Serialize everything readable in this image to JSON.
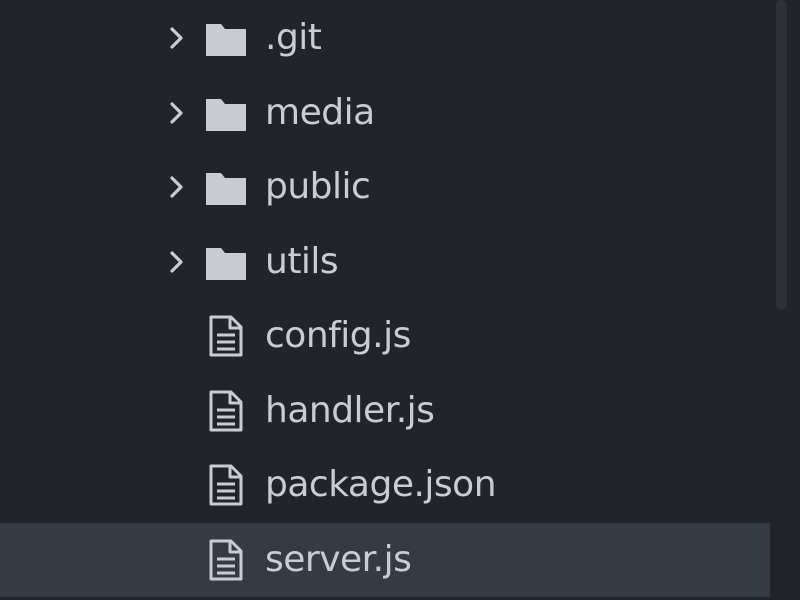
{
  "tree": {
    "items": [
      {
        "label": ".git",
        "type": "folder",
        "icon": "folder-icon",
        "expanded": false,
        "selected": false
      },
      {
        "label": "media",
        "type": "folder",
        "icon": "folder-icon",
        "expanded": false,
        "selected": false
      },
      {
        "label": "public",
        "type": "folder",
        "icon": "folder-icon",
        "expanded": false,
        "selected": false
      },
      {
        "label": "utils",
        "type": "folder",
        "icon": "folder-icon",
        "expanded": false,
        "selected": false
      },
      {
        "label": "config.js",
        "type": "file",
        "icon": "file-icon",
        "selected": false
      },
      {
        "label": "handler.js",
        "type": "file",
        "icon": "file-icon",
        "selected": false
      },
      {
        "label": "package.json",
        "type": "file",
        "icon": "file-icon",
        "selected": false
      },
      {
        "label": "server.js",
        "type": "file",
        "icon": "file-icon",
        "selected": true
      }
    ]
  },
  "colors": {
    "background": "#21252b",
    "selection": "#353b45",
    "text": "#c9ccd2",
    "icon": "#c9ccd2"
  }
}
